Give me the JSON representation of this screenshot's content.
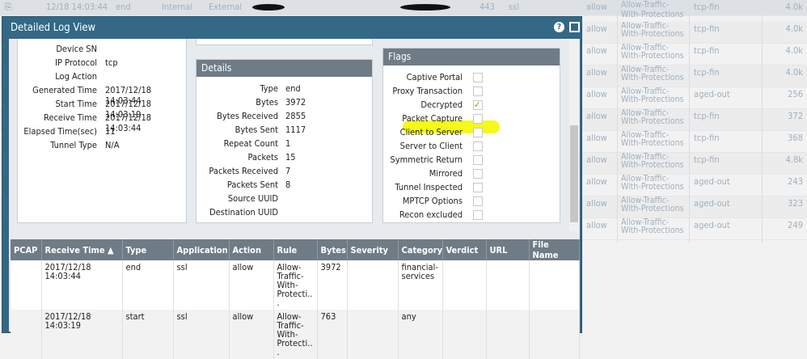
{
  "background_log": {
    "top_row": {
      "time": "12/18 14:03:44",
      "type": "end",
      "from_zone": "Internal",
      "to_zone": "External",
      "port": "443",
      "app": "ssl",
      "action": "allow",
      "rule": "Allow-Traffic-With-Protections",
      "end_reason": "tcp-fin",
      "bytes": "4.0k"
    },
    "rows": [
      {
        "action": "allow",
        "rule": "Allow-Traffic-With-Protections",
        "end_reason": "tcp-fin",
        "bytes": "4.0k"
      },
      {
        "action": "allow",
        "rule": "Allow-Traffic-With-Protections",
        "end_reason": "tcp-fin",
        "bytes": "4.0k"
      },
      {
        "action": "allow",
        "rule": "Allow-Traffic-With-Protections",
        "end_reason": "tcp-fin",
        "bytes": "4.0k"
      },
      {
        "action": "allow",
        "rule": "Allow-Traffic-With-Protections",
        "end_reason": "aged-out",
        "bytes": "256"
      },
      {
        "action": "allow",
        "rule": "Allow-Traffic-With-Protections",
        "end_reason": "tcp-fin",
        "bytes": "372"
      },
      {
        "action": "allow",
        "rule": "Allow-Traffic-With-Protections",
        "end_reason": "tcp-fin",
        "bytes": "368"
      },
      {
        "action": "allow",
        "rule": "Allow-Traffic-With-Protections",
        "end_reason": "tcp-fin",
        "bytes": "4.8k"
      },
      {
        "action": "allow",
        "rule": "Allow-Traffic-With-Protections",
        "end_reason": "aged-out",
        "bytes": "243"
      },
      {
        "action": "allow",
        "rule": "Allow-Traffic-With-Protections",
        "end_reason": "aged-out",
        "bytes": "323"
      },
      {
        "action": "allow",
        "rule": "Allow-Traffic-With-Protections",
        "end_reason": "aged-out",
        "bytes": "249"
      }
    ]
  },
  "dialog": {
    "title": "Detailed Log View",
    "help": "?"
  },
  "general": [
    {
      "k": "Device SN",
      "v": ""
    },
    {
      "k": "IP Protocol",
      "v": "tcp"
    },
    {
      "k": "Log Action",
      "v": ""
    },
    {
      "k": "Generated Time",
      "v": "2017/12/18 14:03:44"
    },
    {
      "k": "Start Time",
      "v": "2017/12/18 14:03:19"
    },
    {
      "k": "Receive Time",
      "v": "2017/12/18 14:03:44"
    },
    {
      "k": "Elapsed Time(sec)",
      "v": "11"
    },
    {
      "k": "Tunnel Type",
      "v": "N/A"
    }
  ],
  "details": {
    "title": "Details",
    "items": [
      {
        "k": "Type",
        "v": "end"
      },
      {
        "k": "Bytes",
        "v": "3972"
      },
      {
        "k": "Bytes Received",
        "v": "2855"
      },
      {
        "k": "Bytes Sent",
        "v": "1117"
      },
      {
        "k": "Repeat Count",
        "v": "1"
      },
      {
        "k": "Packets",
        "v": "15"
      },
      {
        "k": "Packets Received",
        "v": "7"
      },
      {
        "k": "Packets Sent",
        "v": "8"
      },
      {
        "k": "Source UUID",
        "v": ""
      },
      {
        "k": "Destination UUID",
        "v": ""
      }
    ]
  },
  "flags": {
    "title": "Flags",
    "items": [
      {
        "k": "Captive Portal",
        "checked": false
      },
      {
        "k": "Proxy Transaction",
        "checked": false
      },
      {
        "k": "Decrypted",
        "checked": true
      },
      {
        "k": "Packet Capture",
        "checked": false
      },
      {
        "k": "Client to Server",
        "checked": false
      },
      {
        "k": "Server to Client",
        "checked": false
      },
      {
        "k": "Symmetric Return",
        "checked": false
      },
      {
        "k": "Mirrored",
        "checked": false
      },
      {
        "k": "Tunnel Inspected",
        "checked": false
      },
      {
        "k": "MPTCP Options",
        "checked": false
      },
      {
        "k": "Recon excluded",
        "checked": false
      }
    ]
  },
  "related": {
    "columns": [
      "PCAP",
      "Receive Time ▲",
      "Type",
      "Application",
      "Action",
      "Rule",
      "Bytes",
      "Severity",
      "Category",
      "Verdict",
      "URL",
      "File Name"
    ],
    "rows": [
      [
        "",
        "2017/12/18 14:03:44",
        "end",
        "ssl",
        "allow",
        "Allow-Traffic-With-Protecti...",
        "3972",
        "",
        "financial-services",
        "",
        "",
        ""
      ],
      [
        "",
        "2017/12/18 14:03:19",
        "start",
        "ssl",
        "allow",
        "Allow-Traffic-With-Protecti...",
        "763",
        "",
        "any",
        "",
        "",
        ""
      ]
    ]
  }
}
